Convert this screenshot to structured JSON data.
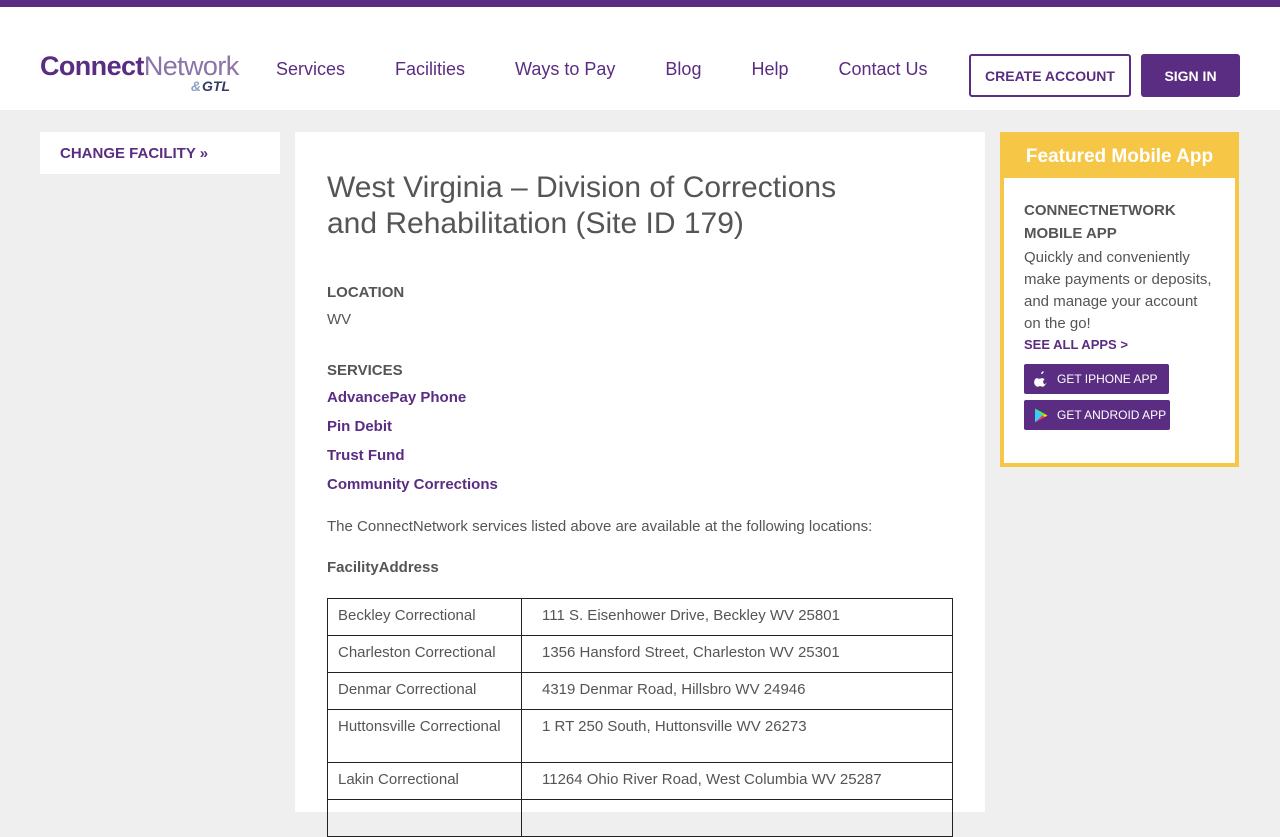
{
  "brand": {
    "logo_bold": "Connect",
    "logo_light": "Network",
    "logo_sub": "GTL"
  },
  "nav": {
    "items": [
      {
        "label": "Services"
      },
      {
        "label": "Facilities"
      },
      {
        "label": "Ways to Pay"
      },
      {
        "label": "Blog"
      },
      {
        "label": "Help"
      },
      {
        "label": "Contact Us"
      }
    ],
    "create_account": "CREATE ACCOUNT",
    "sign_in": "SIGN IN"
  },
  "sidebar": {
    "change_facility": "CHANGE FACILITY »"
  },
  "facility": {
    "title": "West Virginia – Division of Corrections and Rehabilitation (Site ID 179)",
    "location_label": "LOCATION",
    "location_value": "WV",
    "services_label": "SERVICES",
    "services": [
      "AdvancePay Phone",
      "Pin Debit",
      "Trust Fund",
      "Community Corrections"
    ],
    "intro": "The ConnectNetwork services listed above are available at the following locations:",
    "table_header": "FacilityAddress",
    "rows": [
      {
        "name": "Beckley Correctional",
        "address": "111 S. Eisenhower Drive, Beckley WV 25801"
      },
      {
        "name": "Charleston Correctional",
        "address": "1356 Hansford Street, Charleston WV 25301"
      },
      {
        "name": "Denmar Correctional",
        "address": "4319 Denmar Road, Hillsbro WV 24946"
      },
      {
        "name": "Huttonsville Correctional",
        "address": "1 RT 250 South, Huttonsville WV 26273"
      },
      {
        "name": "Lakin Correctional",
        "address": "11264 Ohio River Road, West Columbia WV 25287"
      }
    ]
  },
  "featured_app": {
    "header": "Featured Mobile App",
    "title": "CONNECTNETWORK MOBILE APP",
    "description": "Quickly and conveniently make payments or deposits, and manage your account on the go!",
    "see_all": "SEE ALL APPS >",
    "iphone": "GET IPHONE APP",
    "android": "GET ANDROID APP"
  },
  "colors": {
    "brand_purple": "#5a2d82",
    "accent_yellow": "#f6c646",
    "page_bg": "#efefef"
  },
  "icons": {
    "iphone": "apple-icon",
    "android": "google-play-icon"
  }
}
